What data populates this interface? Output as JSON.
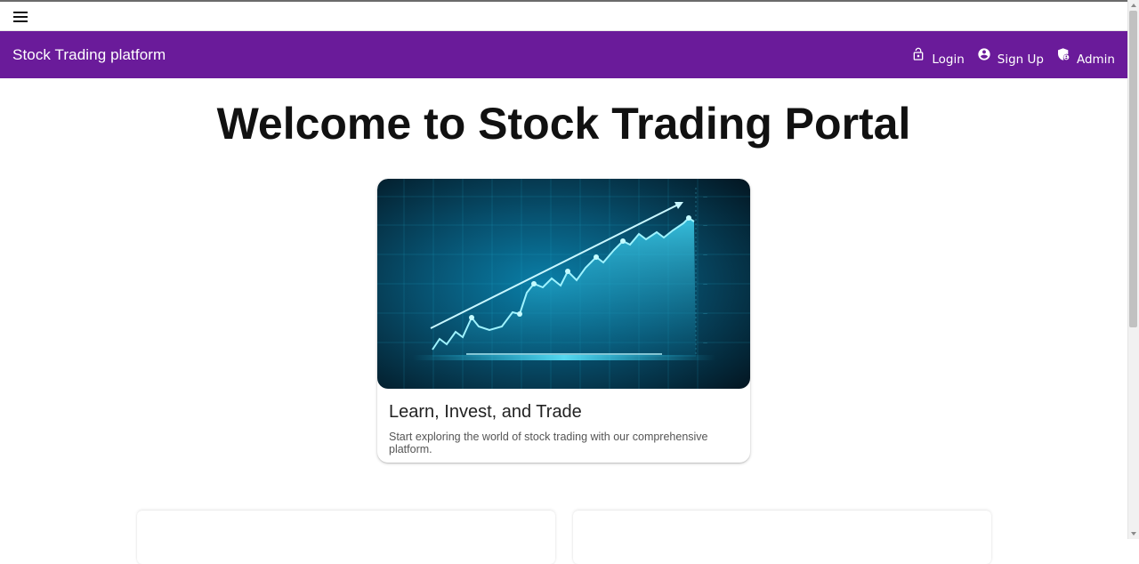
{
  "app": {
    "brand": "Stock Trading platform",
    "accent_color": "#6a1b9a"
  },
  "nav": {
    "items": [
      {
        "label": "Login",
        "icon": "lock-open-icon"
      },
      {
        "label": "Sign Up",
        "icon": "account-circle-icon"
      },
      {
        "label": "Admin",
        "icon": "admin-shield-icon"
      }
    ]
  },
  "hero": {
    "heading": "Welcome to Stock Trading Portal"
  },
  "card": {
    "image": "stock-growth-chart-illustration",
    "title": "Learn, Invest, and Trade",
    "description": "Start exploring the world of stock trading with our comprehensive platform."
  }
}
